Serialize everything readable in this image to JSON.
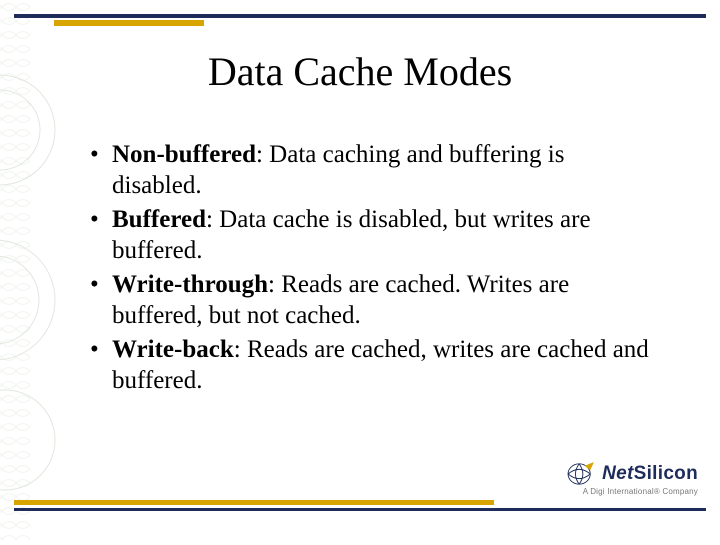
{
  "title": "Data Cache Modes",
  "bullets": [
    {
      "term": "Non-buffered",
      "desc": ":  Data caching and buffering is disabled."
    },
    {
      "term": "Buffered",
      "desc": ":  Data cache is disabled, but writes are buffered."
    },
    {
      "term": "Write-through",
      "desc": ":  Reads are cached.  Writes are buffered, but not cached."
    },
    {
      "term": "Write-back",
      "desc": ":  Reads are cached, writes are cached and buffered."
    }
  ],
  "logo": {
    "brand_a": "Net",
    "brand_b": "Silicon",
    "tagline": "A Digi International® Company"
  },
  "colors": {
    "rule_dark": "#1d2c5a",
    "rule_accent": "#d8a400"
  }
}
